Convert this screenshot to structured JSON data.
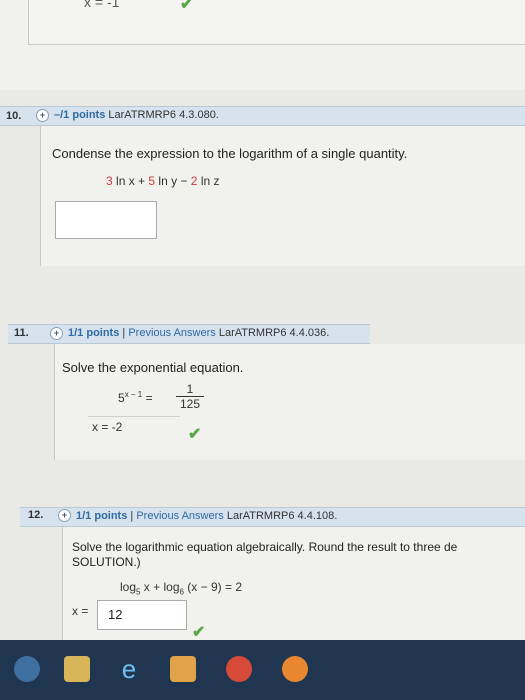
{
  "top": {
    "answer_prefix": "x =",
    "answer_value": "-1"
  },
  "q10": {
    "number": "10.",
    "points": "–/1 points",
    "source": "LarATRMRP6 4.3.080.",
    "prompt": "Condense the expression to the logarithm of a single quantity.",
    "expression": {
      "c1": "3",
      "t1": "ln x +",
      "c2": "5",
      "t2": "ln y −",
      "c3": "2",
      "t3": "ln z"
    }
  },
  "q11": {
    "number": "11.",
    "points": "1/1 points",
    "prev_link": "Previous Answers",
    "source": "LarATRMRP6 4.4.036.",
    "prompt": "Solve the exponential equation.",
    "eq_lhs": "5",
    "eq_exp": "x − 1",
    "eq_eq": "=",
    "eq_num": "1",
    "eq_den": "125",
    "answer_prefix": "x =",
    "answer_value": "-2"
  },
  "q12": {
    "number": "12.",
    "points": "1/1 points",
    "prev_link": "Previous Answers",
    "source": "LarATRMRP6 4.4.108.",
    "prompt_line1": "Solve the logarithmic equation algebraically. Round the result to three de",
    "prompt_line2": "SOLUTION.)",
    "equation": "log",
    "eq_sub1": "5",
    "eq_mid": " x + log",
    "eq_sub2": "6",
    "eq_end": "(x − 9) = 2",
    "answer_prefix": "x =",
    "answer_value": "12"
  },
  "colors": {
    "header_bg": "#d6e2ee",
    "link": "#2f6aa0",
    "correct": "#5aa84a",
    "highlight": "#d13b3b"
  },
  "taskbar_icons": [
    "start-icon",
    "file-explorer-icon",
    "internet-explorer-icon",
    "media-player-icon",
    "chrome-icon",
    "firefox-icon"
  ]
}
